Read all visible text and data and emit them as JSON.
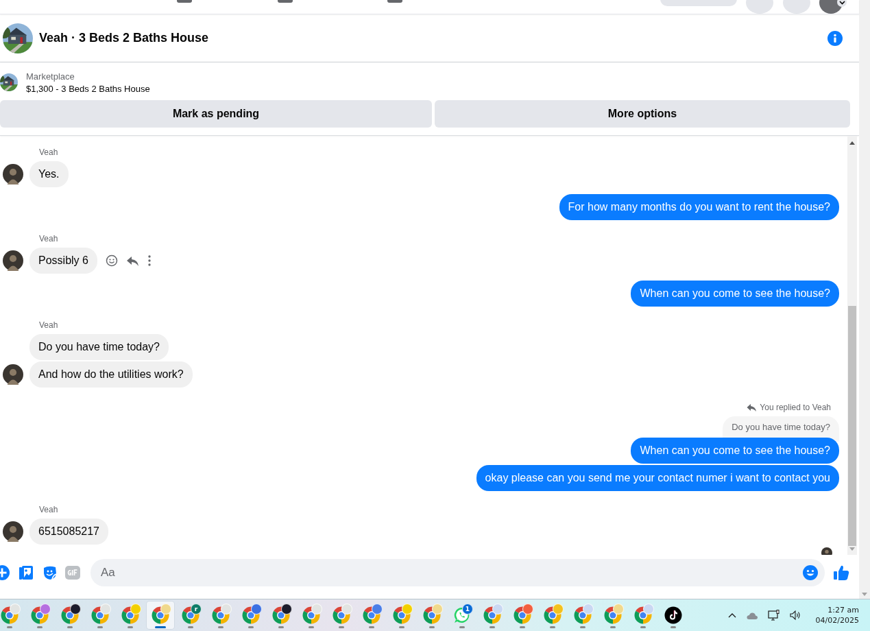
{
  "conversation": {
    "title": "Veah · 3 Beds 2 Baths House"
  },
  "listing": {
    "source": "Marketplace",
    "title": "$1,300 - 3 Beds 2 Baths House",
    "buttons": [
      "Mark as pending",
      "More options"
    ]
  },
  "messages": [
    {
      "kind": "incoming",
      "sender": "Veah",
      "texts": [
        "Yes."
      ],
      "show_actions": false
    },
    {
      "kind": "outgoing",
      "texts": [
        "For how many months do you want to rent the house?"
      ]
    },
    {
      "kind": "incoming",
      "sender": "Veah",
      "texts": [
        "Possibly 6"
      ],
      "show_actions": true
    },
    {
      "kind": "outgoing",
      "texts": [
        "When can you come to see the house?"
      ]
    },
    {
      "kind": "incoming",
      "sender": "Veah",
      "texts": [
        "Do you have time today?",
        "And how do the utilities work?"
      ],
      "show_actions": false
    },
    {
      "kind": "outgoing",
      "reply_label": "You replied to Veah",
      "quoted": "Do you have time today?",
      "texts": [
        "When can you come to see the house?",
        "okay please can you send me your contact numer i want to contact you"
      ]
    },
    {
      "kind": "incoming",
      "sender": "Veah",
      "texts": [
        "6515085217"
      ],
      "show_actions": false
    }
  ],
  "seen": true,
  "composer": {
    "placeholder": "Aa"
  },
  "taskbar": {
    "apps": [
      {
        "kind": "chrome",
        "color": "#e2e4e2",
        "selected": false
      },
      {
        "kind": "chrome",
        "color": "#b56fe0",
        "selected": false
      },
      {
        "kind": "chrome",
        "color": "#1b1b2b",
        "selected": false
      },
      {
        "kind": "chrome",
        "color": "#e2e4e2",
        "selected": false
      },
      {
        "kind": "chrome",
        "color": "#f2d000",
        "selected": false
      },
      {
        "kind": "chrome",
        "color": "#f0d98c",
        "selected": true
      },
      {
        "kind": "chrome",
        "color": "#0e7c68",
        "badge_text": "r",
        "selected": false
      },
      {
        "kind": "chrome",
        "color": "#e2e4e2",
        "selected": false
      },
      {
        "kind": "chrome",
        "color": "#3b6fe2",
        "selected": false
      },
      {
        "kind": "chrome",
        "color": "#1b1b2b",
        "selected": false
      },
      {
        "kind": "chrome",
        "color": "#e2e4e2",
        "selected": false
      },
      {
        "kind": "chrome",
        "color": "#e2e4e2",
        "selected": false
      },
      {
        "kind": "chrome",
        "color": "#4a7ee8",
        "selected": false
      },
      {
        "kind": "chrome",
        "color": "#f2d000",
        "selected": false
      },
      {
        "kind": "chrome",
        "color": "#f0d98c",
        "selected": false
      },
      {
        "kind": "whatsapp",
        "badge_text": "1",
        "selected": false
      },
      {
        "kind": "chrome",
        "color": "#c9d8f2",
        "selected": false
      },
      {
        "kind": "chrome",
        "color": "#f2603f",
        "selected": false
      },
      {
        "kind": "chrome",
        "color": "#f2c21f",
        "selected": false
      },
      {
        "kind": "chrome",
        "color": "#c9d8f2",
        "selected": false
      },
      {
        "kind": "chrome",
        "color": "#f0d98c",
        "selected": false
      },
      {
        "kind": "chrome",
        "color": "#c9d8f2",
        "selected": false
      },
      {
        "kind": "tiktok",
        "selected": false
      }
    ],
    "time": "1:27 am",
    "date": "04/02/2025"
  }
}
